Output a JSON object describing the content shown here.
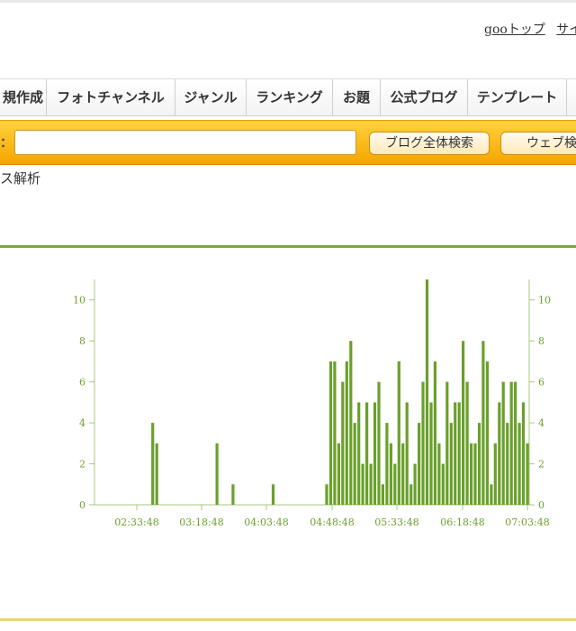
{
  "toplinks": [
    "gooトップ",
    "サイ"
  ],
  "nav": [
    {
      "label": "規作成",
      "w": 52
    },
    {
      "label": "フォトチャンネル",
      "w": 143
    },
    {
      "label": "ジャンル",
      "w": 79
    },
    {
      "label": "ランキング",
      "w": 96
    },
    {
      "label": "お題",
      "w": 53
    },
    {
      "label": "公式ブログ",
      "w": 97
    },
    {
      "label": "テンプレート",
      "w": 110
    },
    {
      "label": "",
      "w": 20
    }
  ],
  "search": {
    "prefix": "：",
    "value": "",
    "blog_button": "ブログ全体検索",
    "web_button": "ウェブ検"
  },
  "section_title": "ス解析",
  "chart_data": {
    "type": "bar",
    "color": "#6aa02b",
    "ylim": [
      0,
      11
    ],
    "yticks": [
      0,
      2,
      4,
      6,
      8,
      10
    ],
    "xticks": [
      "02:33:48",
      "03:18:48",
      "04:03:48",
      "04:48:48",
      "05:33:48",
      "06:18:48",
      "07:03:48"
    ],
    "x_range_minutes": [
      0,
      300
    ],
    "x_labels_note_minutes": [
      45,
      90,
      135,
      180,
      225,
      270,
      315
    ],
    "bars": [
      {
        "t": 20,
        "v": 4
      },
      {
        "t": 23,
        "v": 3
      },
      {
        "t": 68,
        "v": 3
      },
      {
        "t": 80,
        "v": 1
      },
      {
        "t": 110,
        "v": 1
      },
      {
        "t": 150,
        "v": 1
      },
      {
        "t": 153,
        "v": 7
      },
      {
        "t": 156,
        "v": 7
      },
      {
        "t": 159,
        "v": 3
      },
      {
        "t": 162,
        "v": 6
      },
      {
        "t": 165,
        "v": 7
      },
      {
        "t": 168,
        "v": 8
      },
      {
        "t": 171,
        "v": 4
      },
      {
        "t": 174,
        "v": 5
      },
      {
        "t": 177,
        "v": 2
      },
      {
        "t": 180,
        "v": 5
      },
      {
        "t": 183,
        "v": 2
      },
      {
        "t": 186,
        "v": 5
      },
      {
        "t": 189,
        "v": 6
      },
      {
        "t": 192,
        "v": 1
      },
      {
        "t": 195,
        "v": 4
      },
      {
        "t": 198,
        "v": 3
      },
      {
        "t": 201,
        "v": 2
      },
      {
        "t": 204,
        "v": 7
      },
      {
        "t": 207,
        "v": 3
      },
      {
        "t": 210,
        "v": 5
      },
      {
        "t": 213,
        "v": 1
      },
      {
        "t": 216,
        "v": 2
      },
      {
        "t": 219,
        "v": 4
      },
      {
        "t": 222,
        "v": 6
      },
      {
        "t": 225,
        "v": 11
      },
      {
        "t": 228,
        "v": 5
      },
      {
        "t": 231,
        "v": 7
      },
      {
        "t": 234,
        "v": 3
      },
      {
        "t": 237,
        "v": 2
      },
      {
        "t": 240,
        "v": 6
      },
      {
        "t": 243,
        "v": 4
      },
      {
        "t": 246,
        "v": 5
      },
      {
        "t": 249,
        "v": 5
      },
      {
        "t": 252,
        "v": 8
      },
      {
        "t": 255,
        "v": 6
      },
      {
        "t": 258,
        "v": 3
      },
      {
        "t": 261,
        "v": 3
      },
      {
        "t": 264,
        "v": 4
      },
      {
        "t": 267,
        "v": 8
      },
      {
        "t": 270,
        "v": 7
      },
      {
        "t": 273,
        "v": 1
      },
      {
        "t": 276,
        "v": 3
      },
      {
        "t": 279,
        "v": 5
      },
      {
        "t": 282,
        "v": 6
      },
      {
        "t": 285,
        "v": 4
      },
      {
        "t": 288,
        "v": 6
      },
      {
        "t": 291,
        "v": 6
      },
      {
        "t": 294,
        "v": 4
      },
      {
        "t": 297,
        "v": 5
      },
      {
        "t": 300,
        "v": 3
      }
    ]
  }
}
